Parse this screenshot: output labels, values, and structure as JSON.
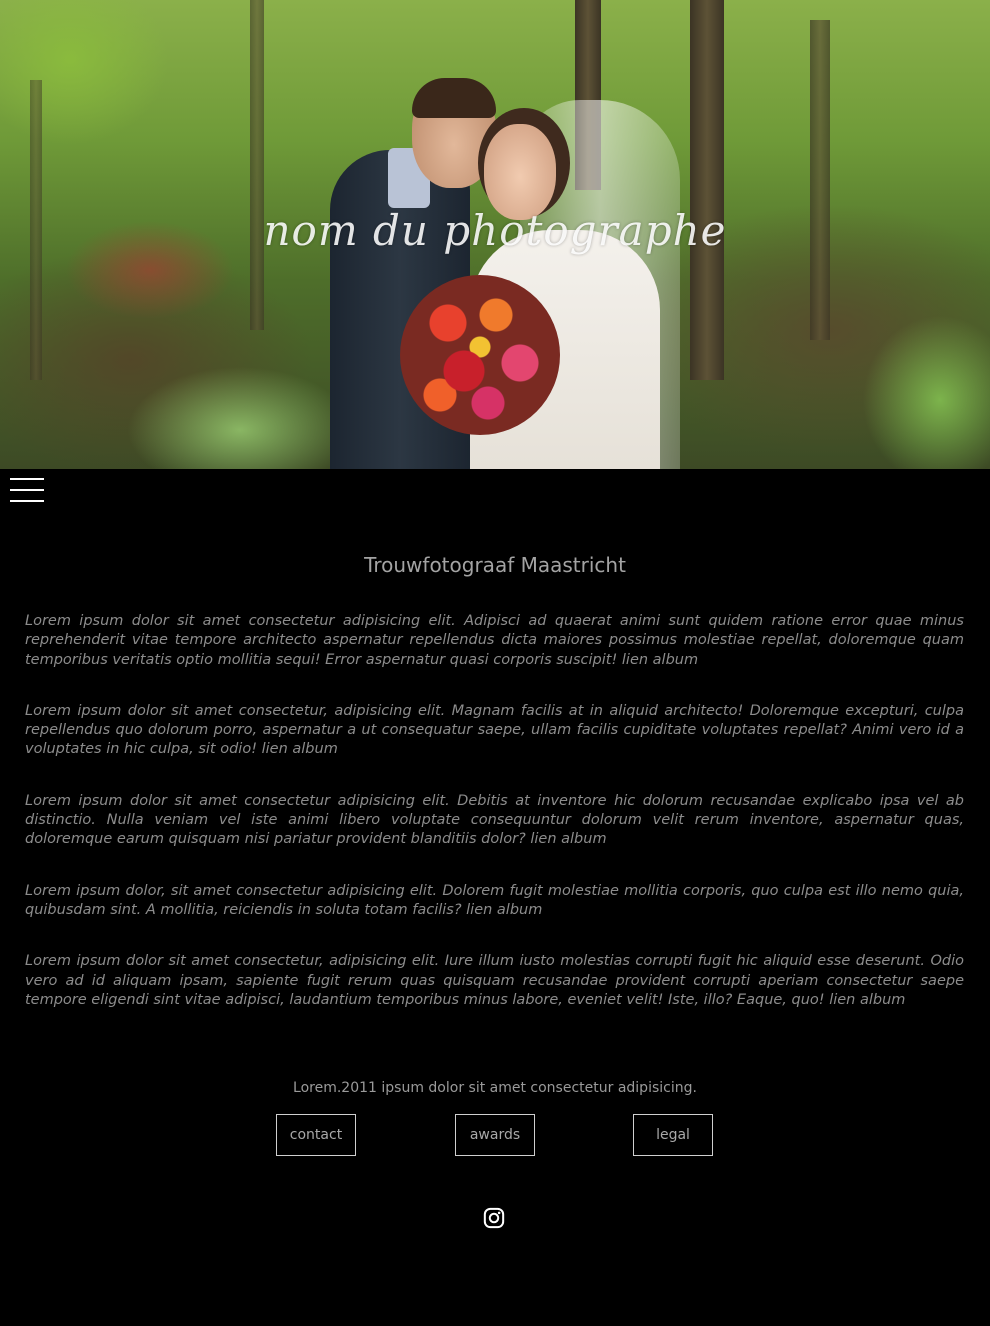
{
  "hero": {
    "title": "nom du photographe"
  },
  "nav": {
    "menu_icon": "hamburger-menu-icon"
  },
  "main": {
    "title": "Trouwfotograaf Maastricht",
    "paragraphs": [
      "Lorem ipsum dolor sit amet consectetur adipisicing elit. Adipisci ad quaerat animi sunt quidem ratione error quae minus reprehenderit vitae tempore architecto aspernatur repellendus dicta maiores possimus molestiae repellat, doloremque quam temporibus veritatis optio mollitia sequi! Error aspernatur quasi corporis suscipit! lien album",
      "Lorem ipsum dolor sit amet consectetur, adipisicing elit. Magnam facilis at in aliquid architecto! Doloremque excepturi, culpa repellendus quo dolorum porro, aspernatur a ut consequatur saepe, ullam facilis cupiditate voluptates repellat? Animi vero id a voluptates in hic culpa, sit odio! lien album",
      "Lorem ipsum dolor sit amet consectetur adipisicing elit. Debitis at inventore hic dolorum recusandae explicabo ipsa vel ab distinctio. Nulla veniam vel iste animi libero voluptate consequuntur dolorum velit rerum inventore, aspernatur quas, doloremque earum quisquam nisi pariatur provident blanditiis dolor? lien album",
      "Lorem ipsum dolor, sit amet consectetur adipisicing elit. Dolorem fugit molestiae mollitia corporis, quo culpa est illo nemo quia, quibusdam sint. A mollitia, reiciendis in soluta totam facilis? lien album",
      "Lorem ipsum dolor sit amet consectetur, adipisicing elit. Iure illum iusto molestias corrupti fugit hic aliquid esse deserunt. Odio vero ad id aliquam ipsam, sapiente fugit rerum quas quisquam recusandae provident corrupti aperiam consectetur saepe tempore eligendi sint vitae adipisci, laudantium temporibus minus labore, eveniet velit! Iste, illo? Eaque, quo! lien album"
    ]
  },
  "footer": {
    "text": "Lorem.2011 ipsum dolor sit amet consectetur adipisicing.",
    "buttons": {
      "contact": "contact",
      "awards": "awards",
      "legal": "legal"
    },
    "social_icon": "instagram-icon"
  },
  "colors": {
    "background": "#000000",
    "text": "#9a9a9a",
    "button_border": "#cfcfcf"
  }
}
